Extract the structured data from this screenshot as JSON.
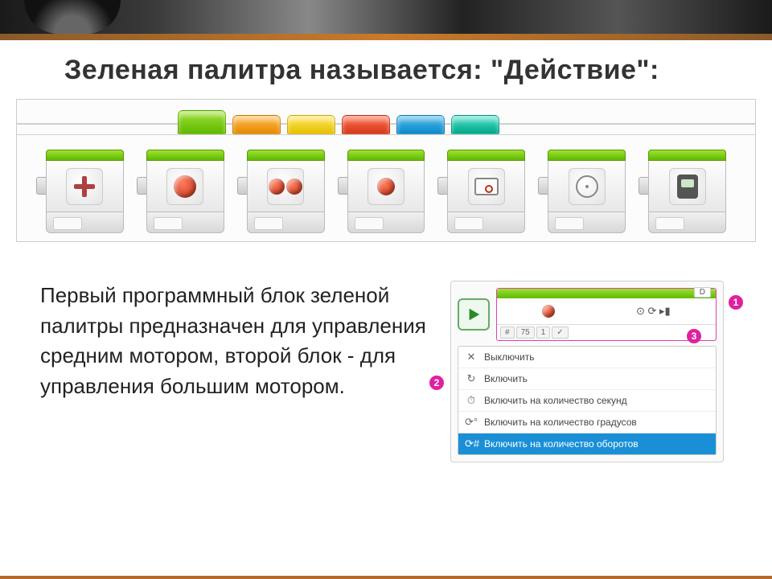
{
  "title": "Зеленая палитра называется: \"Действие\":",
  "palette_tabs": [
    {
      "name": "green",
      "color": "#5fba00"
    },
    {
      "name": "orange",
      "color": "#e68a00"
    },
    {
      "name": "yellow",
      "color": "#e6c200"
    },
    {
      "name": "red",
      "color": "#d63a1a"
    },
    {
      "name": "blue",
      "color": "#0a8acc"
    },
    {
      "name": "teal",
      "color": "#00a688"
    }
  ],
  "blocks": [
    {
      "name": "medium-motor"
    },
    {
      "name": "large-motor"
    },
    {
      "name": "two-large-motors"
    },
    {
      "name": "steering"
    },
    {
      "name": "display"
    },
    {
      "name": "sound"
    },
    {
      "name": "brick-status-light"
    }
  ],
  "description": "Первый программный блок зеленой палитры предназначен для управления средним мотором, второй блок - для управления большим мотором.",
  "callout": {
    "port": "D",
    "params": {
      "rotations_icon": "#",
      "val1": "75",
      "val2": "1",
      "check": "✓"
    },
    "badges": {
      "one": "1",
      "two": "2",
      "three": "3"
    },
    "menu": [
      {
        "icon": "✕",
        "label": "Выключить"
      },
      {
        "icon": "↻",
        "label": "Включить"
      },
      {
        "icon": "⏱",
        "label": "Включить на количество секунд"
      },
      {
        "icon": "⟳°",
        "label": "Включить на количество градусов"
      },
      {
        "icon": "⟳#",
        "label": "Включить на количество оборотов",
        "selected": true
      }
    ]
  }
}
